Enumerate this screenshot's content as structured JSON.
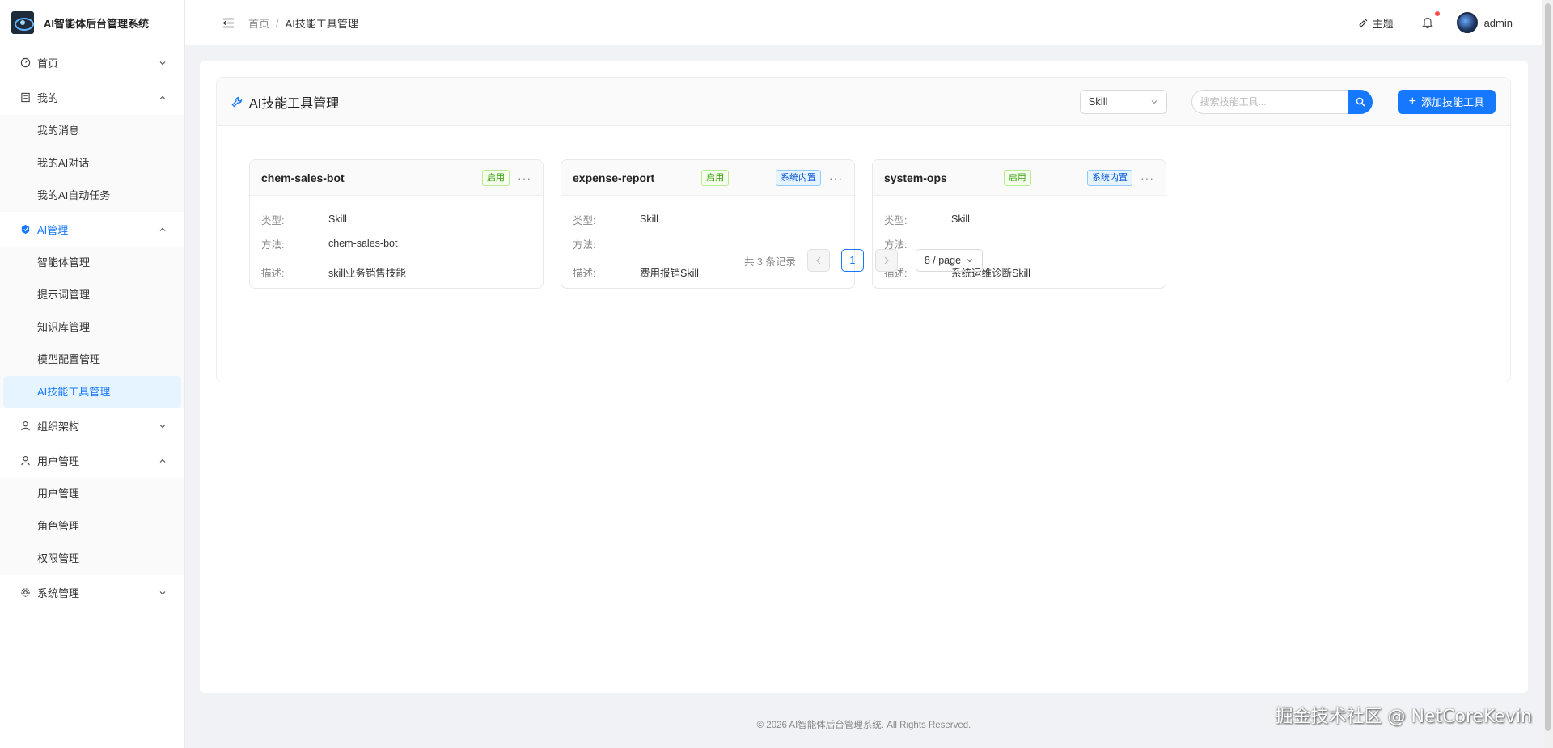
{
  "app": {
    "title": "AI智能体后台管理系统"
  },
  "sidebar": {
    "groups": [
      {
        "label": "首页",
        "icon": "dashboard-icon",
        "expanded": false,
        "items": []
      },
      {
        "label": "我的",
        "icon": "profile-icon",
        "expanded": true,
        "items": [
          "我的消息",
          "我的AI对话",
          "我的AI自动任务"
        ]
      },
      {
        "label": "AI管理",
        "icon": "ai-icon",
        "expanded": true,
        "active": true,
        "items": [
          "智能体管理",
          "提示词管理",
          "知识库管理",
          "模型配置管理",
          "AI技能工具管理"
        ],
        "selected": "AI技能工具管理"
      },
      {
        "label": "组织架构",
        "icon": "user-icon",
        "expanded": false,
        "items": []
      },
      {
        "label": "用户管理",
        "icon": "user-icon",
        "expanded": true,
        "items": [
          "用户管理",
          "角色管理",
          "权限管理"
        ]
      },
      {
        "label": "系统管理",
        "icon": "gear-icon",
        "expanded": false,
        "items": []
      }
    ]
  },
  "header": {
    "breadcrumb": [
      "首页",
      "AI技能工具管理"
    ],
    "theme_label": "主题",
    "username": "admin"
  },
  "page": {
    "title": "AI技能工具管理",
    "type_select": "Skill",
    "search_placeholder": "搜索技能工具...",
    "add_label": "添加技能工具",
    "field_labels": {
      "type": "类型:",
      "method": "方法:",
      "desc": "描述:"
    },
    "tools": [
      {
        "name": "chem-sales-bot",
        "status": "启用",
        "builtin": "",
        "type": "Skill",
        "method": "chem-sales-bot",
        "desc": "skill业务销售技能"
      },
      {
        "name": "expense-report",
        "status": "启用",
        "builtin": "系统内置",
        "type": "Skill",
        "method": "",
        "desc": "费用报销Skill"
      },
      {
        "name": "system-ops",
        "status": "启用",
        "builtin": "系统内置",
        "type": "Skill",
        "method": "",
        "desc": "系统运维诊断Skill"
      }
    ],
    "more_label": "···",
    "pagination": {
      "total_text": "共 3 条记录",
      "current": "1",
      "page_size": "8 / page"
    }
  },
  "footer": {
    "text": "© 2026 AI智能体后台管理系统. All Rights Reserved."
  },
  "watermark": "掘金技术社区 @ NetCoreKevin",
  "colors": {
    "primary": "#1677ff",
    "enabled_tag": "#389e0d",
    "builtin_tag": "#0958d9"
  }
}
